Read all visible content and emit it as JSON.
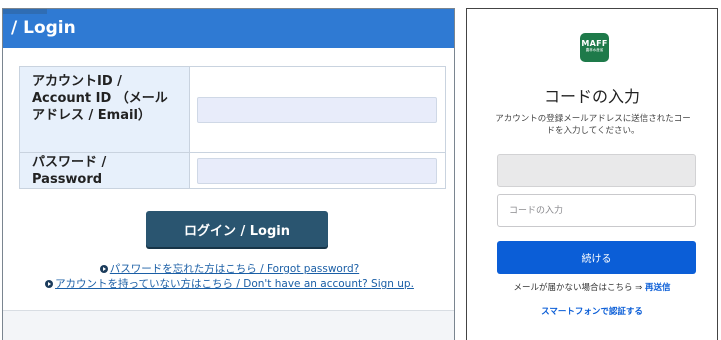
{
  "login_panel": {
    "header_title": "/ Login",
    "account_label": "アカウントID / Account ID （メールアドレス / Email）",
    "account_value": "",
    "password_label": "パスワード / Password",
    "password_value": "",
    "login_button": "ログイン / Login",
    "forgot_link": "パスワードを忘れた方はこちら / Forgot password?",
    "signup_link": "アカウントを持っていない方はこちら / Don't have an account? Sign up."
  },
  "code_panel": {
    "logo_title": "MAFF",
    "logo_subtitle": "農林水産省",
    "heading": "コードの入力",
    "instructions": "アカウントの登録メールアドレスに送信されたコードを入力してください。",
    "email_value": "",
    "code_placeholder": "コードの入力",
    "continue_button": "続ける",
    "resend_prompt": "メールが届かない場合はこちら ⇒ ",
    "resend_link": "再送信",
    "smartphone_link": "スマートフォンで認証する"
  },
  "colors": {
    "login_header": "#2f7ad3",
    "login_button": "#2a5570",
    "label_background": "#e7f0fb",
    "link_blue": "#1b5fa6",
    "continue_button": "#0b5ed7",
    "logo_green": "#1e7a4a"
  }
}
